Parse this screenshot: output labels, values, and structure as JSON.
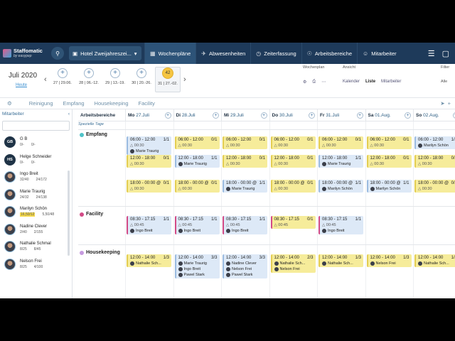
{
  "brand": {
    "name": "Staffomatic",
    "sub": "by easypep"
  },
  "org": "Hotel Zweijahreszei...",
  "nav": [
    {
      "label": "Wochenpläne",
      "icon": "calendar-icon"
    },
    {
      "label": "Abwesenheiten",
      "icon": "plane-icon"
    },
    {
      "label": "Zeiterfassung",
      "icon": "clock-icon"
    },
    {
      "label": "Arbeitsbereiche",
      "icon": "area-icon"
    },
    {
      "label": "Mitarbeiter",
      "icon": "people-icon"
    }
  ],
  "month": "Juli 2020",
  "today": "Heute",
  "weeks": [
    {
      "label": "27 | 29.06."
    },
    {
      "label": "28 | 06.-12."
    },
    {
      "label": "29 | 13.-19."
    },
    {
      "label": "30 | 20.-26."
    },
    {
      "label": "31 | 27.-02.",
      "badge": "42"
    }
  ],
  "toolbar": {
    "wochenplan": "Wochenplan",
    "ansicht": "Ansicht",
    "kalender": "Kalender",
    "liste": "Liste",
    "mitarbeiter": "Mitarbeiter",
    "filter": "Filter",
    "alle": "Alle"
  },
  "filters": [
    "Reinigung",
    "Empfang",
    "Housekeeping",
    "Facility"
  ],
  "sidebar": {
    "title": "Mitarbeiter",
    "employees": [
      {
        "name": "G B",
        "initials": "GB",
        "a": "0/-",
        "b": "0/-"
      },
      {
        "name": "Helge Schneider",
        "initials": "HS",
        "a": "0/-",
        "b": "0/-"
      },
      {
        "name": "Ingo Breit",
        "a": "32/40",
        "b": "24/172"
      },
      {
        "name": "Marie Traurig",
        "a": "24/32",
        "b": "24/138"
      },
      {
        "name": "Marilyn Schön",
        "a": "16,50/12",
        "b": "5,50/48",
        "highlight": true
      },
      {
        "name": "Nadine Clever",
        "a": "2/40",
        "b": "2/155"
      },
      {
        "name": "Nathalie Schmal",
        "a": "8/25",
        "b": "8/45"
      },
      {
        "name": "Nelson Frei",
        "a": "8/25",
        "b": "4/100"
      }
    ]
  },
  "grid": {
    "areas_label": "Arbeitsbereiche",
    "special": "Spezielle Tage",
    "days": [
      {
        "dow": "Mo",
        "date": "27.Juli"
      },
      {
        "dow": "Di",
        "date": "28.Juli"
      },
      {
        "dow": "Mi",
        "date": "29.Juli"
      },
      {
        "dow": "Do",
        "date": "30.Juli"
      },
      {
        "dow": "Fr",
        "date": "31.Juli"
      },
      {
        "dow": "Sa",
        "date": "01.Aug."
      },
      {
        "dow": "So",
        "date": "02.Aug."
      }
    ],
    "areas": [
      {
        "name": "Empfang",
        "color": "#4fc3c8"
      },
      {
        "name": "Facility",
        "color": "#d24a86"
      },
      {
        "name": "Housekeeping",
        "color": "#c69adf"
      }
    ],
    "shifts": [
      {
        "d": 0,
        "area": 0,
        "slot": 0,
        "color": "blue",
        "time": "06:00 - 12:00",
        "count": "1/1",
        "sub": "00:30",
        "who": [
          "Marie Traurig"
        ]
      },
      {
        "d": 0,
        "area": 0,
        "slot": 1,
        "color": "yellow",
        "time": "12:00 - 18:00",
        "count": "0/1",
        "sub": "00:30",
        "who": []
      },
      {
        "d": 0,
        "area": 0,
        "slot": 2,
        "color": "yellow",
        "time": "18:00 - 00:00 @",
        "count": "0/1",
        "sub": "00:30",
        "who": []
      },
      {
        "d": 1,
        "area": 0,
        "slot": 0,
        "color": "yellow",
        "time": "06:00 - 12:00",
        "count": "0/1",
        "sub": "00:30",
        "who": []
      },
      {
        "d": 1,
        "area": 0,
        "slot": 1,
        "color": "blue",
        "time": "12:00 - 18:00",
        "count": "1/1",
        "sub": "",
        "who": [
          "Marie Traurig"
        ]
      },
      {
        "d": 1,
        "area": 0,
        "slot": 2,
        "color": "yellow",
        "time": "18:00 - 00:00 @",
        "count": "0/1",
        "sub": "00:30",
        "who": []
      },
      {
        "d": 2,
        "area": 0,
        "slot": 0,
        "color": "yellow",
        "time": "06:00 - 12:00",
        "count": "0/1",
        "sub": "00:30",
        "who": []
      },
      {
        "d": 2,
        "area": 0,
        "slot": 1,
        "color": "yellow",
        "time": "12:00 - 18:00",
        "count": "0/1",
        "sub": "00:30",
        "who": []
      },
      {
        "d": 2,
        "area": 0,
        "slot": 2,
        "color": "blue",
        "time": "18:00 - 00:00 @",
        "count": "1/1",
        "sub": "",
        "who": [
          "Marie Traurig"
        ]
      },
      {
        "d": 3,
        "area": 0,
        "slot": 0,
        "color": "yellow",
        "time": "06:00 - 12:00",
        "count": "0/1",
        "sub": "00:30",
        "who": []
      },
      {
        "d": 3,
        "area": 0,
        "slot": 1,
        "color": "yellow",
        "time": "12:00 - 18:00",
        "count": "0/1",
        "sub": "00:30",
        "who": []
      },
      {
        "d": 3,
        "area": 0,
        "slot": 2,
        "color": "yellow",
        "time": "18:00 - 00:00 @",
        "count": "0/1",
        "sub": "00:30",
        "who": []
      },
      {
        "d": 4,
        "area": 0,
        "slot": 0,
        "color": "yellow",
        "time": "06:00 - 12:00",
        "count": "0/1",
        "sub": "00:30",
        "who": []
      },
      {
        "d": 4,
        "area": 0,
        "slot": 1,
        "color": "blue",
        "time": "12:00 - 18:00",
        "count": "1/1",
        "sub": "",
        "who": [
          "Marie Traurig"
        ]
      },
      {
        "d": 4,
        "area": 0,
        "slot": 2,
        "color": "blue",
        "time": "18:00 - 00:00 @",
        "count": "1/1",
        "sub": "",
        "who": [
          "Marilyn Schön"
        ]
      },
      {
        "d": 5,
        "area": 0,
        "slot": 0,
        "color": "yellow",
        "time": "06:00 - 12:00",
        "count": "0/1",
        "sub": "00:30",
        "who": []
      },
      {
        "d": 5,
        "area": 0,
        "slot": 1,
        "color": "yellow",
        "time": "12:00 - 18:00",
        "count": "0/1",
        "sub": "00:30",
        "who": []
      },
      {
        "d": 5,
        "area": 0,
        "slot": 2,
        "color": "blue",
        "time": "18:00 - 00:00 @",
        "count": "1/1",
        "sub": "",
        "who": [
          "Marilyn Schön"
        ]
      },
      {
        "d": 6,
        "area": 0,
        "slot": 0,
        "color": "blue",
        "time": "06:00 - 12:00",
        "count": "1/1",
        "sub": "",
        "who": [
          "Marilyn Schön"
        ]
      },
      {
        "d": 6,
        "area": 0,
        "slot": 1,
        "color": "yellow",
        "time": "12:00 - 18:00",
        "count": "0/1",
        "sub": "00:30",
        "who": []
      },
      {
        "d": 6,
        "area": 0,
        "slot": 2,
        "color": "yellow",
        "time": "18:00 - 00:00 @",
        "count": "0/1",
        "sub": "00:30",
        "who": []
      },
      {
        "d": 0,
        "area": 1,
        "slot": 0,
        "color": "blue pink",
        "time": "08:30 - 17:15",
        "count": "1/1",
        "sub": "00:45",
        "who": [
          "Ingo Breit"
        ]
      },
      {
        "d": 1,
        "area": 1,
        "slot": 0,
        "color": "blue pink",
        "time": "08:30 - 17:15",
        "count": "1/1",
        "sub": "00:45",
        "who": [
          "Ingo Breit"
        ]
      },
      {
        "d": 2,
        "area": 1,
        "slot": 0,
        "color": "blue pink",
        "time": "08:30 - 17:15",
        "count": "1/1",
        "sub": "00:45",
        "who": [
          "Ingo Breit"
        ]
      },
      {
        "d": 3,
        "area": 1,
        "slot": 0,
        "color": "yellow pink",
        "time": "08:30 - 17:15",
        "count": "0/1",
        "sub": "00:45",
        "who": []
      },
      {
        "d": 4,
        "area": 1,
        "slot": 0,
        "color": "blue pink",
        "time": "08:30 - 17:15",
        "count": "1/1",
        "sub": "00:45",
        "who": [
          "Ingo Breit"
        ]
      },
      {
        "d": 0,
        "area": 2,
        "slot": 0,
        "color": "yellow",
        "time": "12:00 - 14:00",
        "count": "1/3",
        "sub": "",
        "who": [
          "Nathalie Sch..."
        ]
      },
      {
        "d": 1,
        "area": 2,
        "slot": 0,
        "color": "blue",
        "time": "12:00 - 14:00",
        "count": "3/3",
        "sub": "",
        "who": [
          "Marie Traurig",
          "Ingo Breit",
          "Pawel Stark"
        ]
      },
      {
        "d": 2,
        "area": 2,
        "slot": 0,
        "color": "blue",
        "time": "12:00 - 14:00",
        "count": "3/3",
        "sub": "",
        "who": [
          "Nadine Clever",
          "Nelson Frei",
          "Pawel Stark"
        ]
      },
      {
        "d": 3,
        "area": 2,
        "slot": 0,
        "color": "yellow",
        "time": "12:00 - 14:00",
        "count": "2/3",
        "sub": "",
        "who": [
          "Nathalie Sch...",
          "Nelson Frei"
        ]
      },
      {
        "d": 4,
        "area": 2,
        "slot": 0,
        "color": "yellow",
        "time": "12:00 - 14:00",
        "count": "1/3",
        "sub": "",
        "who": [
          "Nathalie Sch..."
        ]
      },
      {
        "d": 5,
        "area": 2,
        "slot": 0,
        "color": "yellow",
        "time": "12:00 - 14:00",
        "count": "1/3",
        "sub": "",
        "who": [
          "Nelson Frei"
        ]
      },
      {
        "d": 6,
        "area": 2,
        "slot": 0,
        "color": "yellow",
        "time": "12:00 - 14:00",
        "count": "1/3",
        "sub": "",
        "who": [
          "Nathalie Sch..."
        ]
      }
    ]
  }
}
